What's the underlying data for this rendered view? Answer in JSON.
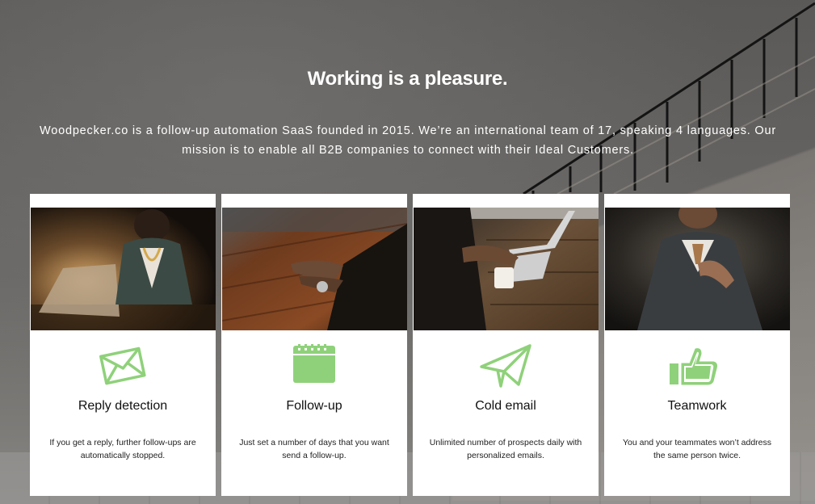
{
  "hero": {
    "title": "Working is a pleasure.",
    "intro": "Woodpecker.co is a follow-up automation SaaS founded in 2015. We’re an international team of 17, speaking 4 languages. Our mission is to enable all B2B companies to connect with their Ideal Customers."
  },
  "features": [
    {
      "icon": "envelope-icon",
      "heading": "Reply detection",
      "description": "If you get a reply, further follow-ups are automatically stopped."
    },
    {
      "icon": "calendar-icon",
      "heading": "Follow-up",
      "description": "Just set a number of days that you want send a follow-up."
    },
    {
      "icon": "paper-plane-icon",
      "heading": "Cold email",
      "description": "Unlimited number of prospects daily with personalized emails."
    },
    {
      "icon": "thumbs-up-icon",
      "heading": "Teamwork",
      "description": "You and your teammates won’t address the same person twice."
    }
  ],
  "colors": {
    "accent_green": "#8fd17a",
    "card_background": "#ffffff",
    "hero_text": "#ffffff"
  }
}
